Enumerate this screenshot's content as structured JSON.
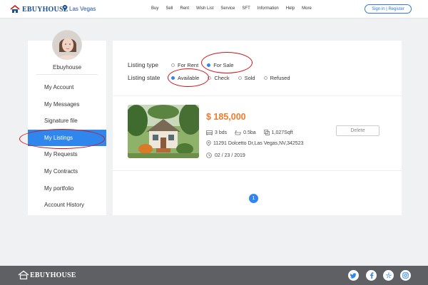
{
  "header": {
    "brand": "EBUYHOUSE",
    "location": "Las Vegas",
    "nav": [
      "Buy",
      "Sell",
      "Rent",
      "Wish List",
      "Service",
      "SFT",
      "Information",
      "Help",
      "More"
    ],
    "signin_label": "Sign in  |  Register"
  },
  "sidebar": {
    "username": "Ebuyhouse",
    "items": [
      {
        "label": "My Account"
      },
      {
        "label": "My Messages"
      },
      {
        "label": "Signature file"
      },
      {
        "label": "My Listings",
        "active": true
      },
      {
        "label": "My Requests"
      },
      {
        "label": "My Contracts"
      },
      {
        "label": "My portfolio"
      },
      {
        "label": "Account History"
      }
    ]
  },
  "filters": {
    "listing_type_label": "Listing type",
    "listing_type_options": [
      {
        "label": "For Rent",
        "selected": false
      },
      {
        "label": "For Sale",
        "selected": true
      }
    ],
    "listing_state_label": "Listing state",
    "listing_state_options": [
      {
        "label": "Available",
        "selected": true
      },
      {
        "label": "Check",
        "selected": false
      },
      {
        "label": "Sold",
        "selected": false
      },
      {
        "label": "Refused",
        "selected": false
      }
    ]
  },
  "listing": {
    "price": "$ 185,000",
    "beds": "3 bds",
    "baths": "0.5ba",
    "sqft": "1,027Sqft",
    "address": "11291 Dolcetto Dr,Las Vegas,NV,342523",
    "date": "02 / 23 / 2019",
    "delete_label": "Delete"
  },
  "pagination": {
    "current": "1"
  },
  "footer": {
    "brand": "EBUYHOUSE",
    "social": [
      "twitter-icon",
      "facebook-icon",
      "yelp-icon",
      "instagram-icon"
    ]
  },
  "colors": {
    "brand_blue": "#1b4f9c",
    "accent_blue": "#2f87ed",
    "price_orange": "#f27a2a",
    "annotation_red": "#d0161c",
    "footer_gray": "#5f6064"
  }
}
